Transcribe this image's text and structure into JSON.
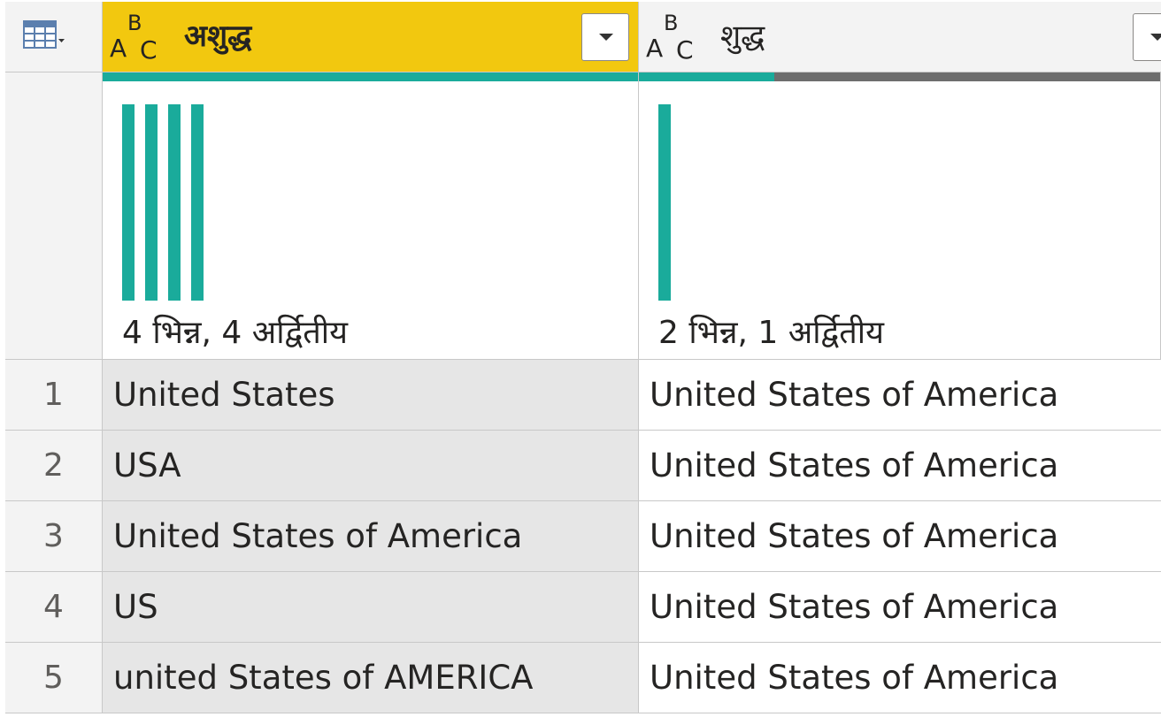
{
  "grid": {
    "corner_icon": "table-menu-icon",
    "columns": [
      {
        "type_icon": "text-type-icon",
        "type_letters": [
          "A",
          "B",
          "C"
        ],
        "name": "अशुद्ध",
        "selected": true,
        "header_color": "#f2c80f",
        "valid_fraction": 1.0,
        "distribution": [
          1,
          1,
          1,
          1
        ],
        "profile_text": "4 भिन्न, 4 अर्द्वितीय"
      },
      {
        "type_icon": "text-type-icon",
        "type_letters": [
          "A",
          "B",
          "C"
        ],
        "name": "शुद्ध",
        "selected": false,
        "header_color": "#f3f3f3",
        "valid_fraction": 0.26,
        "distribution": [
          1
        ],
        "profile_text": "2 भिन्न, 1 अर्द्वितीय"
      }
    ],
    "rows": [
      {
        "index": "1",
        "values": [
          "United States",
          "United States of America"
        ]
      },
      {
        "index": "2",
        "values": [
          "USA",
          "United States of America"
        ]
      },
      {
        "index": "3",
        "values": [
          "United States of America",
          "United States of America"
        ]
      },
      {
        "index": "4",
        "values": [
          "US",
          "United States of America"
        ]
      },
      {
        "index": "5",
        "values": [
          "united States of AMERICA",
          "United States of America"
        ]
      }
    ],
    "colors": {
      "bar": "#1aab9b",
      "quality_valid": "#1aab9b",
      "quality_empty": "#6d6d6d",
      "selected_column_bg": "#e6e6e6"
    }
  }
}
